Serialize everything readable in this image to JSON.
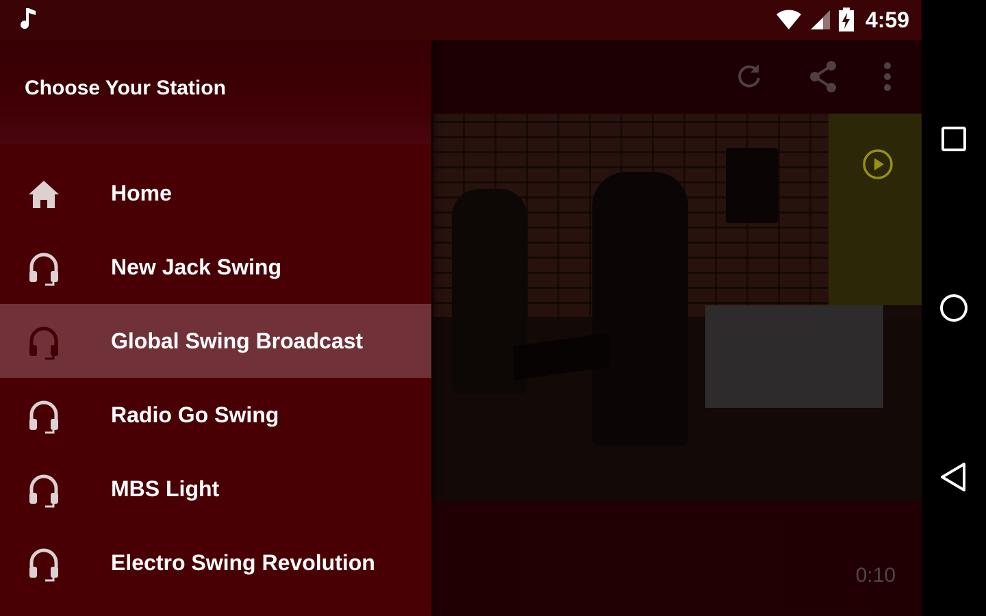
{
  "status_bar": {
    "time": "4:59",
    "icons": [
      "music-note-icon",
      "wifi-icon",
      "cellular-signal-icon",
      "battery-charging-icon"
    ]
  },
  "drawer": {
    "title": "Choose Your Station",
    "items": [
      {
        "label": "Home",
        "icon": "home-icon",
        "selected": false
      },
      {
        "label": "New Jack Swing",
        "icon": "headphones-icon",
        "selected": false
      },
      {
        "label": "Global Swing Broadcast",
        "icon": "headphones-icon",
        "selected": true
      },
      {
        "label": "Radio Go Swing",
        "icon": "headphones-icon",
        "selected": false
      },
      {
        "label": "MBS Light",
        "icon": "headphones-icon",
        "selected": false
      },
      {
        "label": "Electro Swing Revolution",
        "icon": "headphones-icon",
        "selected": false
      }
    ]
  },
  "toolbar": {
    "actions": [
      "refresh-icon",
      "share-icon",
      "more-vert-icon"
    ]
  },
  "player": {
    "elapsed": "0:10",
    "play_icon": "play-circle-icon"
  },
  "nav_bar": {
    "buttons": [
      "recents-button",
      "home-button",
      "back-button"
    ]
  },
  "colors": {
    "primary_dark": "#3a0306",
    "drawer_bg": "#490005",
    "selected_bg": "#703238",
    "accent": "#c8c21a"
  }
}
